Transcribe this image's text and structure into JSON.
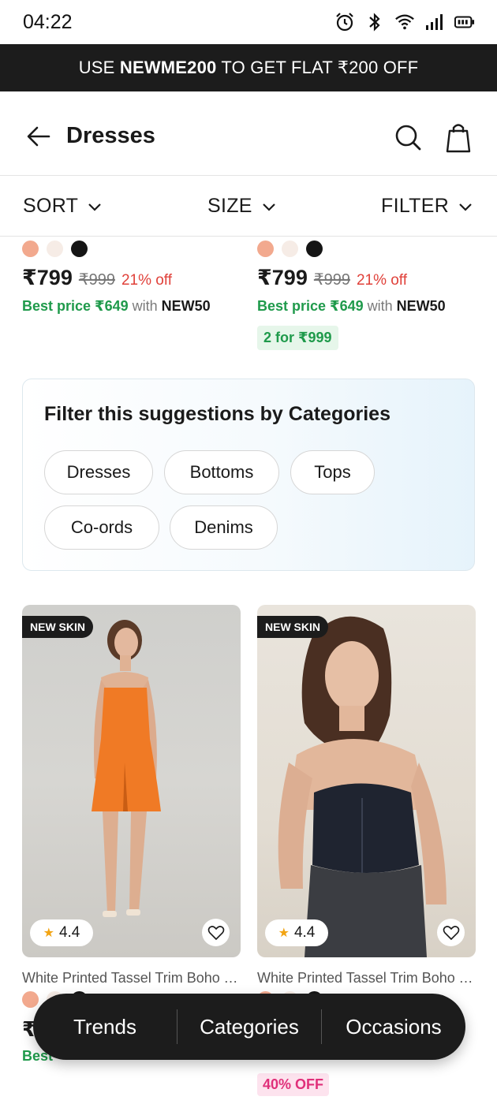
{
  "status_bar": {
    "time": "04:22",
    "icons": [
      "alarm-icon",
      "bluetooth-icon",
      "wifi-icon",
      "signal-icon",
      "battery-icon"
    ]
  },
  "promo": {
    "prefix": "USE ",
    "code": "NEWME200",
    "suffix": " TO GET FLAT ₹200 OFF"
  },
  "header": {
    "title": "Dresses",
    "icons": [
      "back-arrow-icon",
      "search-icon",
      "shopping-bag-icon"
    ]
  },
  "toolbar": {
    "sort": "SORT",
    "size": "SIZE",
    "filter": "FILTER"
  },
  "top_cards": [
    {
      "swatch_colors": [
        "#f2a98e",
        "#f6ece6",
        "#151515"
      ],
      "price": "₹799",
      "mrp": "₹999",
      "off": "21% off",
      "best_label": "Best price ₹649",
      "best_with": "with",
      "best_code": "NEW50"
    },
    {
      "swatch_colors": [
        "#f2a98e",
        "#f6ece6",
        "#151515"
      ],
      "price": "₹799",
      "mrp": "₹999",
      "off": "21% off",
      "best_label": "Best price ₹649",
      "best_with": "with",
      "best_code": "NEW50",
      "combo": "2 for ₹999"
    }
  ],
  "suggestions": {
    "title": "Filter this suggestions by Categories",
    "chips": [
      "Dresses",
      "Bottoms",
      "Tops",
      "Co-ords",
      "Denims"
    ]
  },
  "products": [
    {
      "tag": "NEW SKIN",
      "rating": "4.4",
      "name": "White Printed Tassel Trim Boho T...",
      "swatch_colors": [
        "#f2a98e",
        "#f6ece6",
        "#151515"
      ],
      "price_partial": "₹",
      "best_partial": "Best"
    },
    {
      "tag": "NEW SKIN",
      "rating": "4.4",
      "name": "White Printed Tassel Trim Boho T...",
      "swatch_colors": [
        "#f2a98e",
        "#f6ece6",
        "#151515"
      ],
      "discount": "40% OFF"
    }
  ],
  "float_nav": {
    "items": [
      "Trends",
      "Categories",
      "Occasions"
    ]
  },
  "colors": {
    "accent_dark": "#1c1c1c",
    "price_green": "#1f9a4b",
    "off_red": "#e0413a",
    "discount_pink": "#e0307a"
  }
}
